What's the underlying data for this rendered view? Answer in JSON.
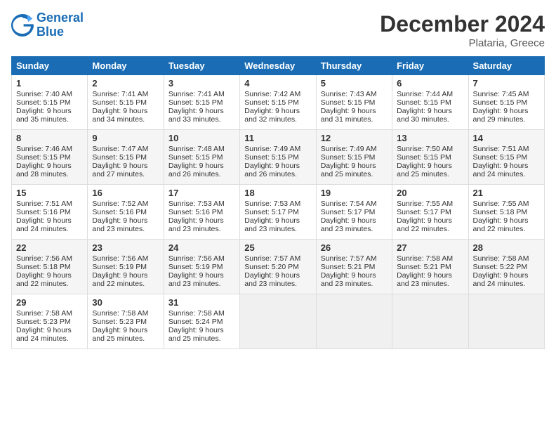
{
  "logo": {
    "line1": "General",
    "line2": "Blue"
  },
  "title": "December 2024",
  "location": "Plataria, Greece",
  "headers": [
    "Sunday",
    "Monday",
    "Tuesday",
    "Wednesday",
    "Thursday",
    "Friday",
    "Saturday"
  ],
  "weeks": [
    [
      {
        "day": "1",
        "sunrise": "Sunrise: 7:40 AM",
        "sunset": "Sunset: 5:15 PM",
        "daylight": "Daylight: 9 hours and 35 minutes."
      },
      {
        "day": "2",
        "sunrise": "Sunrise: 7:41 AM",
        "sunset": "Sunset: 5:15 PM",
        "daylight": "Daylight: 9 hours and 34 minutes."
      },
      {
        "day": "3",
        "sunrise": "Sunrise: 7:41 AM",
        "sunset": "Sunset: 5:15 PM",
        "daylight": "Daylight: 9 hours and 33 minutes."
      },
      {
        "day": "4",
        "sunrise": "Sunrise: 7:42 AM",
        "sunset": "Sunset: 5:15 PM",
        "daylight": "Daylight: 9 hours and 32 minutes."
      },
      {
        "day": "5",
        "sunrise": "Sunrise: 7:43 AM",
        "sunset": "Sunset: 5:15 PM",
        "daylight": "Daylight: 9 hours and 31 minutes."
      },
      {
        "day": "6",
        "sunrise": "Sunrise: 7:44 AM",
        "sunset": "Sunset: 5:15 PM",
        "daylight": "Daylight: 9 hours and 30 minutes."
      },
      {
        "day": "7",
        "sunrise": "Sunrise: 7:45 AM",
        "sunset": "Sunset: 5:15 PM",
        "daylight": "Daylight: 9 hours and 29 minutes."
      }
    ],
    [
      {
        "day": "8",
        "sunrise": "Sunrise: 7:46 AM",
        "sunset": "Sunset: 5:15 PM",
        "daylight": "Daylight: 9 hours and 28 minutes."
      },
      {
        "day": "9",
        "sunrise": "Sunrise: 7:47 AM",
        "sunset": "Sunset: 5:15 PM",
        "daylight": "Daylight: 9 hours and 27 minutes."
      },
      {
        "day": "10",
        "sunrise": "Sunrise: 7:48 AM",
        "sunset": "Sunset: 5:15 PM",
        "daylight": "Daylight: 9 hours and 26 minutes."
      },
      {
        "day": "11",
        "sunrise": "Sunrise: 7:49 AM",
        "sunset": "Sunset: 5:15 PM",
        "daylight": "Daylight: 9 hours and 26 minutes."
      },
      {
        "day": "12",
        "sunrise": "Sunrise: 7:49 AM",
        "sunset": "Sunset: 5:15 PM",
        "daylight": "Daylight: 9 hours and 25 minutes."
      },
      {
        "day": "13",
        "sunrise": "Sunrise: 7:50 AM",
        "sunset": "Sunset: 5:15 PM",
        "daylight": "Daylight: 9 hours and 25 minutes."
      },
      {
        "day": "14",
        "sunrise": "Sunrise: 7:51 AM",
        "sunset": "Sunset: 5:15 PM",
        "daylight": "Daylight: 9 hours and 24 minutes."
      }
    ],
    [
      {
        "day": "15",
        "sunrise": "Sunrise: 7:51 AM",
        "sunset": "Sunset: 5:16 PM",
        "daylight": "Daylight: 9 hours and 24 minutes."
      },
      {
        "day": "16",
        "sunrise": "Sunrise: 7:52 AM",
        "sunset": "Sunset: 5:16 PM",
        "daylight": "Daylight: 9 hours and 23 minutes."
      },
      {
        "day": "17",
        "sunrise": "Sunrise: 7:53 AM",
        "sunset": "Sunset: 5:16 PM",
        "daylight": "Daylight: 9 hours and 23 minutes."
      },
      {
        "day": "18",
        "sunrise": "Sunrise: 7:53 AM",
        "sunset": "Sunset: 5:17 PM",
        "daylight": "Daylight: 9 hours and 23 minutes."
      },
      {
        "day": "19",
        "sunrise": "Sunrise: 7:54 AM",
        "sunset": "Sunset: 5:17 PM",
        "daylight": "Daylight: 9 hours and 23 minutes."
      },
      {
        "day": "20",
        "sunrise": "Sunrise: 7:55 AM",
        "sunset": "Sunset: 5:17 PM",
        "daylight": "Daylight: 9 hours and 22 minutes."
      },
      {
        "day": "21",
        "sunrise": "Sunrise: 7:55 AM",
        "sunset": "Sunset: 5:18 PM",
        "daylight": "Daylight: 9 hours and 22 minutes."
      }
    ],
    [
      {
        "day": "22",
        "sunrise": "Sunrise: 7:56 AM",
        "sunset": "Sunset: 5:18 PM",
        "daylight": "Daylight: 9 hours and 22 minutes."
      },
      {
        "day": "23",
        "sunrise": "Sunrise: 7:56 AM",
        "sunset": "Sunset: 5:19 PM",
        "daylight": "Daylight: 9 hours and 22 minutes."
      },
      {
        "day": "24",
        "sunrise": "Sunrise: 7:56 AM",
        "sunset": "Sunset: 5:19 PM",
        "daylight": "Daylight: 9 hours and 23 minutes."
      },
      {
        "day": "25",
        "sunrise": "Sunrise: 7:57 AM",
        "sunset": "Sunset: 5:20 PM",
        "daylight": "Daylight: 9 hours and 23 minutes."
      },
      {
        "day": "26",
        "sunrise": "Sunrise: 7:57 AM",
        "sunset": "Sunset: 5:21 PM",
        "daylight": "Daylight: 9 hours and 23 minutes."
      },
      {
        "day": "27",
        "sunrise": "Sunrise: 7:58 AM",
        "sunset": "Sunset: 5:21 PM",
        "daylight": "Daylight: 9 hours and 23 minutes."
      },
      {
        "day": "28",
        "sunrise": "Sunrise: 7:58 AM",
        "sunset": "Sunset: 5:22 PM",
        "daylight": "Daylight: 9 hours and 24 minutes."
      }
    ],
    [
      {
        "day": "29",
        "sunrise": "Sunrise: 7:58 AM",
        "sunset": "Sunset: 5:23 PM",
        "daylight": "Daylight: 9 hours and 24 minutes."
      },
      {
        "day": "30",
        "sunrise": "Sunrise: 7:58 AM",
        "sunset": "Sunset: 5:23 PM",
        "daylight": "Daylight: 9 hours and 25 minutes."
      },
      {
        "day": "31",
        "sunrise": "Sunrise: 7:58 AM",
        "sunset": "Sunset: 5:24 PM",
        "daylight": "Daylight: 9 hours and 25 minutes."
      },
      null,
      null,
      null,
      null
    ]
  ]
}
